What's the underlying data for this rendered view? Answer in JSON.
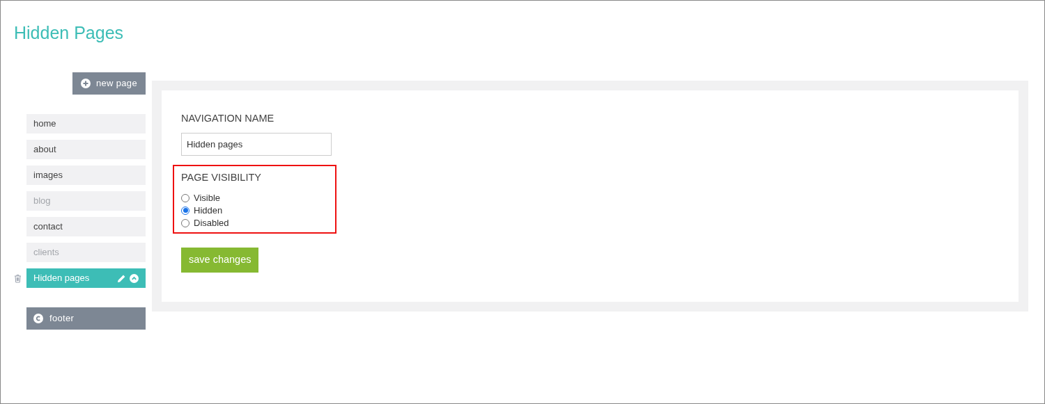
{
  "title": "Hidden Pages",
  "new_page_button": {
    "label": "new page"
  },
  "pages": [
    {
      "label": "home",
      "dimmed": false,
      "selected": false
    },
    {
      "label": "about",
      "dimmed": false,
      "selected": false
    },
    {
      "label": "images",
      "dimmed": false,
      "selected": false
    },
    {
      "label": "blog",
      "dimmed": true,
      "selected": false
    },
    {
      "label": "contact",
      "dimmed": false,
      "selected": false
    },
    {
      "label": "clients",
      "dimmed": true,
      "selected": false
    },
    {
      "label": "Hidden pages",
      "dimmed": false,
      "selected": true
    }
  ],
  "footer_button": {
    "label": "footer"
  },
  "form": {
    "name_label": "NAVIGATION NAME",
    "name_value": "Hidden pages",
    "visibility_label": "PAGE VISIBILITY",
    "options": [
      {
        "label": "Visible",
        "selected": false
      },
      {
        "label": "Hidden",
        "selected": true
      },
      {
        "label": "Disabled",
        "selected": false
      }
    ],
    "save_button": "save changes"
  }
}
